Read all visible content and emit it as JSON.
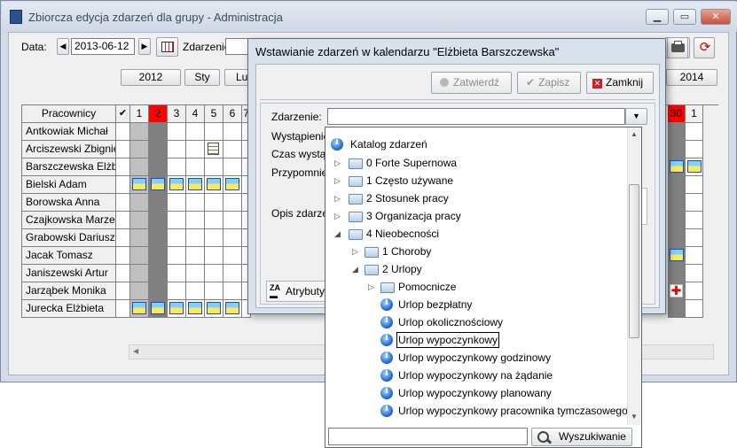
{
  "window": {
    "title": "Zbiorcza edycja zdarzeń dla grupy  - Administracja"
  },
  "toolbar": {
    "date_label": "Data:",
    "date_value": "2013-06-12",
    "event_label": "Zdarzenie:"
  },
  "calendar": {
    "year_left": "2012",
    "month": "Sty",
    "month_partial": "Lut",
    "year_right": "2014",
    "header_label": "Pracownicy",
    "check_mark": "✔",
    "days": [
      "1",
      "2",
      "3",
      "4",
      "5",
      "6",
      "7"
    ],
    "right_days": [
      "30",
      "1"
    ],
    "employees": [
      "Antkowiak Michał",
      "Arciszewski Zbignie",
      "Barszczewska Elżbie",
      "Bielski Adam",
      "Borowska Anna",
      "Czajkowska Marzen",
      "Grabowski Dariusz",
      "Jacak Tomasz",
      "Janiszewski Artur",
      "Jarząbek Monika",
      "Jurecka Elżbieta"
    ]
  },
  "dialog": {
    "title": "Wstawianie zdarzeń w kalendarzu \"Elżbieta Barszczewska\"",
    "confirm_button": "Zatwierdź",
    "save_button": "Zapisz",
    "close_button": "Zamknij",
    "event_field_label": "Zdarzenie:",
    "event_field_value": "",
    "label_occurrence": "Wystąpienie",
    "label_time": "Czas wystąp",
    "label_reminder": "Przypomnie",
    "label_description": "Opis zdarzen",
    "attributes_tab": "Atrybuty"
  },
  "tree": {
    "root": "Katalog zdarzeń",
    "items": [
      "0 Forte Supernowa",
      "1 Często używane",
      "2 Stosunek pracy",
      "3 Organizacja pracy",
      "4 Nieobecności",
      "1 Choroby",
      "2 Urlopy",
      "Pomocnicze",
      "Urlop bezpłatny",
      "Urlop okolicznościowy",
      "Urlop wypoczynkowy",
      "Urlop wypoczynkowy godzinowy",
      "Urlop wypoczynkowy na żądanie",
      "Urlop wypoczynkowy planowany",
      "Urlop wypoczynkowy pracownika tymczasowego"
    ],
    "search_value": "",
    "search_button": "Wyszukiwanie"
  },
  "colors": {
    "highlight_day": "#ff0000",
    "weekend": "#c0c0c0",
    "holiday": "#808080",
    "window_frame": "#d4dbe6"
  }
}
